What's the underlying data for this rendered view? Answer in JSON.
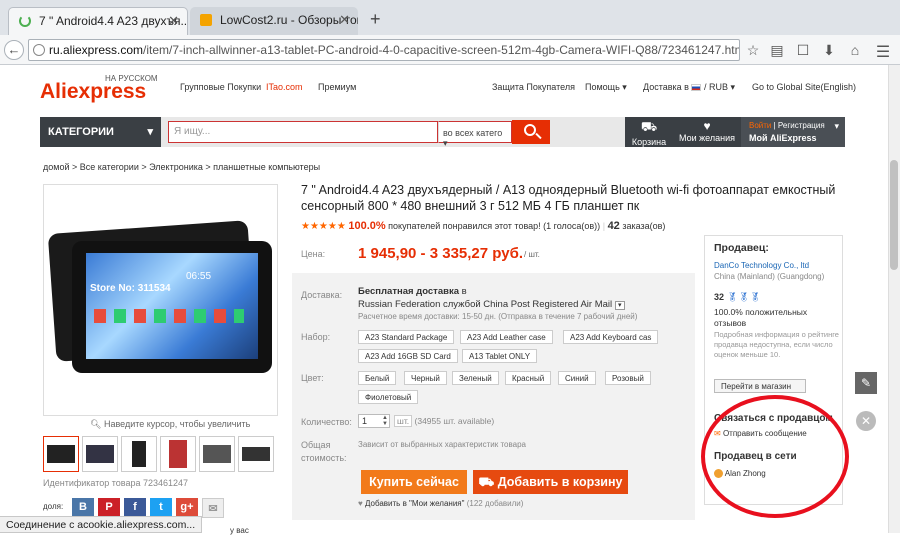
{
  "browser": {
    "tabs": [
      {
        "label": "7 \" Android4.4 A23 двухъя...",
        "active": true
      },
      {
        "label": "LowCost2.ru - Обзоры тов...",
        "active": false
      }
    ],
    "url_domain": "ru.aliexpress.com",
    "url_path": "/item/7-inch-allwinner-a13-tablet-PC-android-4-0-capacitive-screen-512m-4gb-Camera-WIFI-Q88/723461247.html",
    "status": "Соединение с acookie.aliexpress.com..."
  },
  "header": {
    "logo_ali": "Ali",
    "logo_express": "express",
    "logo_sub": "НА РУССКОМ",
    "links": [
      "Групповые Покупки",
      "ITao.com",
      "Премиум"
    ],
    "right_links": [
      "Защита Покупателя",
      "Помощь",
      "Доставка в",
      "/ RUB",
      "Go to Global Site(English)"
    ],
    "categories": "КАТЕГОРИИ",
    "search_placeholder": "Я ищу...",
    "search_category": "во всех катего",
    "cart": "Корзина",
    "wishlist": "Мои желания",
    "login": "Войти",
    "register": "| Регистрация",
    "myali": "Мой AliExpress"
  },
  "breadcrumb": "домой > Все категории > Электроника > планшетные компьютеры",
  "product": {
    "title": "7 \" Android4.4 A23 двухъядерный / A13 одноядерный Bluetooth wi-fi фотоаппарат емкостный сенсорный 800 * 480 внешний 3 г 512 МБ 4 ГБ планшет пк",
    "stars": "★★★★★",
    "rating_pct": "100.0%",
    "rating_text": "покупателей понравился этот товар! (1 голоса(ов))",
    "orders": "42",
    "orders_label": "заказа(ов)",
    "price_label": "Цена:",
    "price": "1 945,90 - 3 335,27 руб.",
    "price_unit": "/ шт.",
    "zoom_hint": "Наведите курсор, чтобы увеличить",
    "product_id": "Идентификатор товара 723461247",
    "share_label": "доля:",
    "screen_text": "Store No: 311534",
    "screen_time": "06:55"
  },
  "delivery": {
    "label": "Доставка:",
    "free": "Бесплатная доставка",
    "in": "в",
    "service": "Russian Federation службой China Post Registered Air Mail",
    "estimate": "Расчетное время доставки: 15-50 дн. (Отправка в течение 7 рабочий дней)"
  },
  "options": {
    "set_label": "Набор:",
    "sets": [
      "A23 Standard Package",
      "A23 Add Leather case",
      "A23 Add Keyboard cas",
      "A23 Add 16GB SD Card",
      "A13 Tablet ONLY"
    ],
    "color_label": "Цвет:",
    "colors": [
      "Белый",
      "Черный",
      "Зеленый",
      "Красный",
      "Синий",
      "Розовый",
      "Фиолетовый"
    ],
    "qty_label": "Количество:",
    "qty": "1",
    "qty_unit": "шт.",
    "qty_available": "(34955 шт. available)",
    "total_label": "Общая стоимость:",
    "total_note": "Зависит от выбранных характеристик товара",
    "buy_now": "Купить сейчас",
    "add_to_cart": "Добавить в корзину",
    "add_wishlist": "Добавить в \"Мои желания\"",
    "wishlist_count": "(122 добавили)"
  },
  "seller": {
    "heading": "Продавец:",
    "name": "DanCo Technology Co., ltd",
    "location": "China (Mainland) (Guangdong)",
    "score": "32",
    "feedback_pct": "100.0% положительных отзывов",
    "note": "Подробная информация о рейтинге продавца недоступна, если число оценок меньше 10.",
    "store_btn": "Перейти в магазин",
    "contact_heading": "Связаться с продавцом",
    "send_message": "Отправить сообщение",
    "online_heading": "Продавец в сети",
    "online_name": "Alan Zhong"
  },
  "footer_partial": "у вас"
}
